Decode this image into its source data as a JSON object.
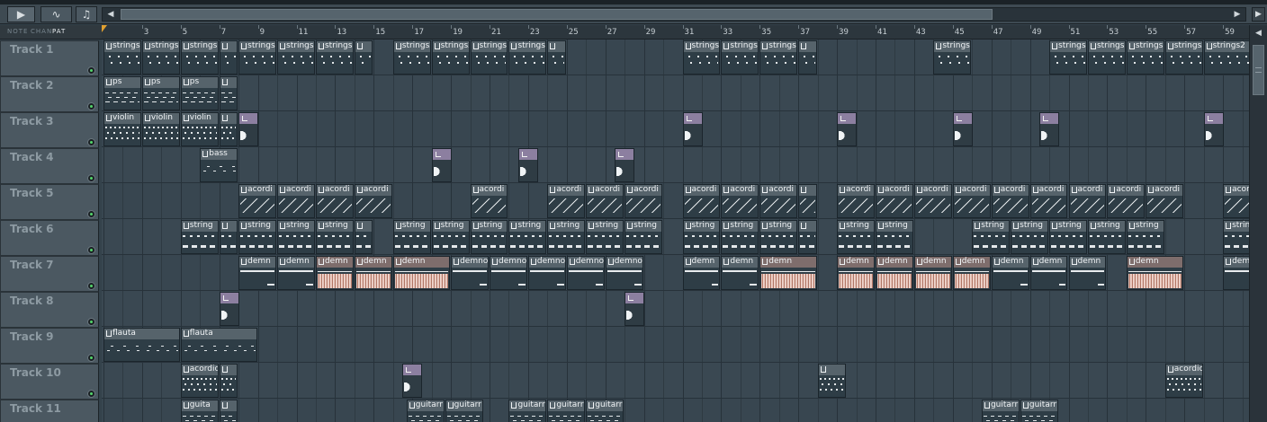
{
  "toolbar": {
    "tools": [
      {
        "name": "song-mode-icon",
        "glyph": "▶"
      },
      {
        "name": "stretch-icon",
        "glyph": "∿"
      },
      {
        "name": "note-icon",
        "glyph": "♫"
      }
    ],
    "scroll_left": "◀",
    "scroll_right": "▶",
    "right_button": "▶"
  },
  "modes": {
    "note": "NOTE",
    "chan": "CHAN",
    "pat": "PAT"
  },
  "ruler": {
    "ticks": [
      "3",
      "5",
      "7",
      "9",
      "11",
      "13",
      "15",
      "17",
      "19",
      "21",
      "23",
      "25",
      "27",
      "29",
      "31",
      "33",
      "35",
      "37",
      "39",
      "41",
      "43",
      "45",
      "47",
      "49",
      "51",
      "53",
      "55",
      "57",
      "59"
    ]
  },
  "tracks": [
    {
      "name": "Track 1"
    },
    {
      "name": "Track 2"
    },
    {
      "name": "Track 3"
    },
    {
      "name": "Track 4"
    },
    {
      "name": "Track 5"
    },
    {
      "name": "Track 6"
    },
    {
      "name": "Track 7"
    },
    {
      "name": "Track 8"
    },
    {
      "name": "Track 9"
    },
    {
      "name": "Track 10"
    },
    {
      "name": "Track 11"
    }
  ],
  "clip_labels": {
    "strings2": "strings2",
    "string_cut": "string",
    "ps": "ps",
    "violin": "violin",
    "bass": "bass",
    "acordio_short": "acordi",
    "string": "string",
    "demn": "demn",
    "demno": "demno",
    "flauta": "flauta",
    "acordio": "acordio",
    "guita": "guita",
    "guitarr": "guitarr",
    "guitar": "guitar"
  },
  "colors": {
    "background": "#34424b",
    "clip_title": "#56636b",
    "audio_clip": "#7e6d6c",
    "sample_title": "#8c7fa0",
    "led_green": "#54d56b",
    "playhead": "#e0a030"
  }
}
